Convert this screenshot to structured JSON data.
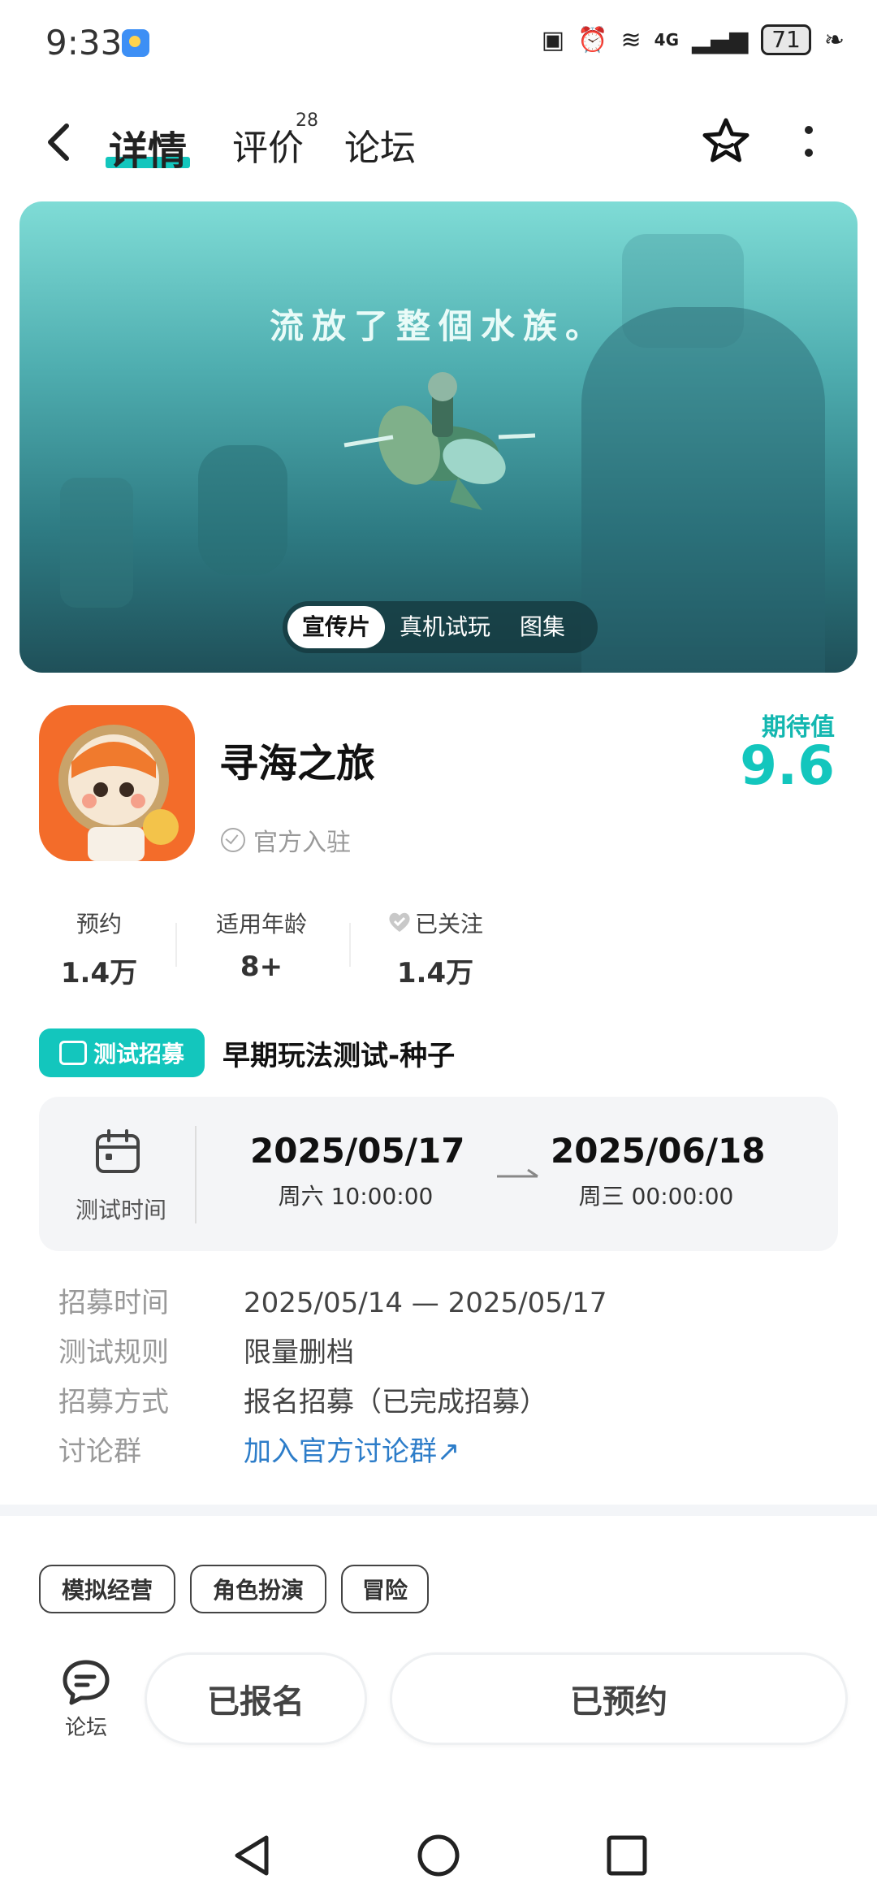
{
  "status_bar": {
    "time": "9:33",
    "signal": "4G",
    "battery": "71"
  },
  "header": {
    "tabs": [
      {
        "label": "详情",
        "active": true
      },
      {
        "label": "评价",
        "count": "28"
      },
      {
        "label": "论坛"
      }
    ]
  },
  "banner": {
    "caption": "流放了整個水族。",
    "segments": [
      "宣传片",
      "真机试玩",
      "图集"
    ],
    "active_segment": "宣传片"
  },
  "app": {
    "name": "寻海之旅",
    "official": "官方入驻",
    "expect_label": "期待值",
    "expect_value": "9.6"
  },
  "stats": [
    {
      "label": "预约",
      "value": "1.4万"
    },
    {
      "label": "适用年龄",
      "value": "8+"
    },
    {
      "label": "已关注",
      "value": "1.4万"
    }
  ],
  "recruit": {
    "badge": "测试招募",
    "title": "早期玩法测试-种子",
    "time_label": "测试时间",
    "start_date": "2025/05/17",
    "start_sub": "周六  10:00:00",
    "end_date": "2025/06/18",
    "end_sub": "周三  00:00:00"
  },
  "info": [
    {
      "key": "招募时间",
      "value": "2025/05/14 — 2025/05/17"
    },
    {
      "key": "测试规则",
      "value": "限量删档"
    },
    {
      "key": "招募方式",
      "value": "报名招募（已完成招募）"
    },
    {
      "key": "讨论群",
      "value": "加入官方讨论群↗",
      "link": true
    }
  ],
  "tags": [
    "模拟经营",
    "角色扮演",
    "冒险"
  ],
  "bottom": {
    "forum_label": "论坛",
    "signed_up": "已报名",
    "reserved": "已预约"
  },
  "colors": {
    "accent": "#13c6bd",
    "link": "#2d7dc9"
  }
}
